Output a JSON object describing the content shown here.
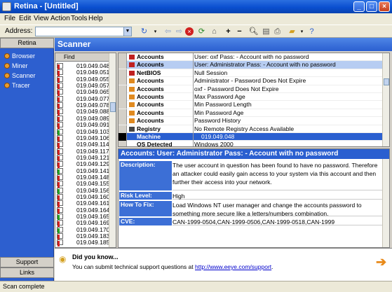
{
  "window": {
    "title": "Retina - [Untitled]"
  },
  "menu": [
    "File",
    "Edit",
    "View",
    "Action",
    "Tools",
    "Help"
  ],
  "address": {
    "label": "Address:",
    "value": ""
  },
  "sidebar": {
    "header": "Retina",
    "items": [
      "Browser",
      "Miner",
      "Scanner",
      "Tracer"
    ],
    "footer_buttons": [
      "Support",
      "Links"
    ]
  },
  "scanner": {
    "title": "Scanner",
    "find_label": "Find"
  },
  "ip_list": [
    {
      "ip": "019.049.048",
      "c": "#d02020"
    },
    {
      "ip": "019.049.051",
      "c": "#d02020"
    },
    {
      "ip": "019.049.055",
      "c": "#d02020"
    },
    {
      "ip": "019.049.057",
      "c": "#d02020"
    },
    {
      "ip": "019.049.065",
      "c": "#d02020"
    },
    {
      "ip": "019.049.077",
      "c": "#d02020"
    },
    {
      "ip": "019.049.078",
      "c": "#d02020"
    },
    {
      "ip": "019.049.088",
      "c": "#d02020"
    },
    {
      "ip": "019.049.089",
      "c": "#d02020"
    },
    {
      "ip": "019.049.091",
      "c": "#d02020"
    },
    {
      "ip": "019.049.103",
      "c": "#22a022"
    },
    {
      "ip": "019.049.106",
      "c": "#d02020"
    },
    {
      "ip": "019.049.114",
      "c": "#d02020"
    },
    {
      "ip": "019.049.117",
      "c": "#d02020"
    },
    {
      "ip": "019.049.121",
      "c": "#d02020"
    },
    {
      "ip": "019.049.129",
      "c": "#d02020"
    },
    {
      "ip": "019.049.141",
      "c": "#22a022"
    },
    {
      "ip": "019.049.148",
      "c": "#d02020"
    },
    {
      "ip": "019.049.155",
      "c": "#d02020"
    },
    {
      "ip": "019.049.156",
      "c": "#22a022"
    },
    {
      "ip": "019.049.160",
      "c": "#d02020"
    },
    {
      "ip": "019.049.161",
      "c": "#d02020"
    },
    {
      "ip": "019.049.164",
      "c": "#d02020"
    },
    {
      "ip": "019.049.165",
      "c": "#22a022"
    },
    {
      "ip": "019.049.169",
      "c": "#d02020"
    },
    {
      "ip": "019.049.170",
      "c": "#22a022"
    },
    {
      "ip": "019.049.183",
      "c": "#d02020"
    },
    {
      "ip": "019.049.185",
      "c": "#d02020"
    }
  ],
  "results": [
    {
      "cat": "Accounts",
      "desc": "User: oxf Pass:  - Account with no password",
      "ic": "#c02020",
      "sel": false
    },
    {
      "cat": "Accounts",
      "desc": "User: Administrator Pass:  - Account with no password",
      "ic": "#c02020",
      "sel": true
    },
    {
      "cat": "NetBIOS",
      "desc": "Null Session",
      "ic": "#c02020",
      "sel": false
    },
    {
      "cat": "Accounts",
      "desc": "Administrator - Password Does Not Expire",
      "ic": "#e08a20",
      "sel": false
    },
    {
      "cat": "Accounts",
      "desc": "oxf - Password Does Not Expire",
      "ic": "#e08a20",
      "sel": false
    },
    {
      "cat": "Accounts",
      "desc": "Max Password Age",
      "ic": "#e08a20",
      "sel": false
    },
    {
      "cat": "Accounts",
      "desc": "Min Password Length",
      "ic": "#e08a20",
      "sel": false
    },
    {
      "cat": "Accounts",
      "desc": "Min Password Age",
      "ic": "#e08a20",
      "sel": false
    },
    {
      "cat": "Accounts",
      "desc": "Password History",
      "ic": "#e08a20",
      "sel": false
    },
    {
      "cat": "Registry",
      "desc": "No Remote Registry Access Available",
      "ic": "#444444",
      "sel": false
    }
  ],
  "machine_row": {
    "label": "Machine",
    "ip": "019.049.048"
  },
  "os_row": {
    "label": "OS Detected",
    "value": "Windows 2000"
  },
  "detail": {
    "header": "Accounts: User: Administrator Pass:  - Account with no password",
    "rows": [
      {
        "label": "Description:",
        "value": "The user account in question has been found to have no password. Therefore an attacker could easily gain access to your system via this account and then further their access into your network."
      },
      {
        "label": "Risk Level:",
        "value": "High"
      },
      {
        "label": "How To Fix:",
        "value": "Load Windows NT user manager and change the accounts password to something more secure like a letters/numbers combination."
      },
      {
        "label": "CVE:",
        "value": "CAN-1999-0504,CAN-1999-0506,CAN-1999-0518,CAN-1999"
      }
    ]
  },
  "tip": {
    "title": "Did you know...",
    "text": "You can submit technical support questions at ",
    "link": "http://www.eeye.com/support",
    "after": "."
  },
  "status": "Scan complete"
}
